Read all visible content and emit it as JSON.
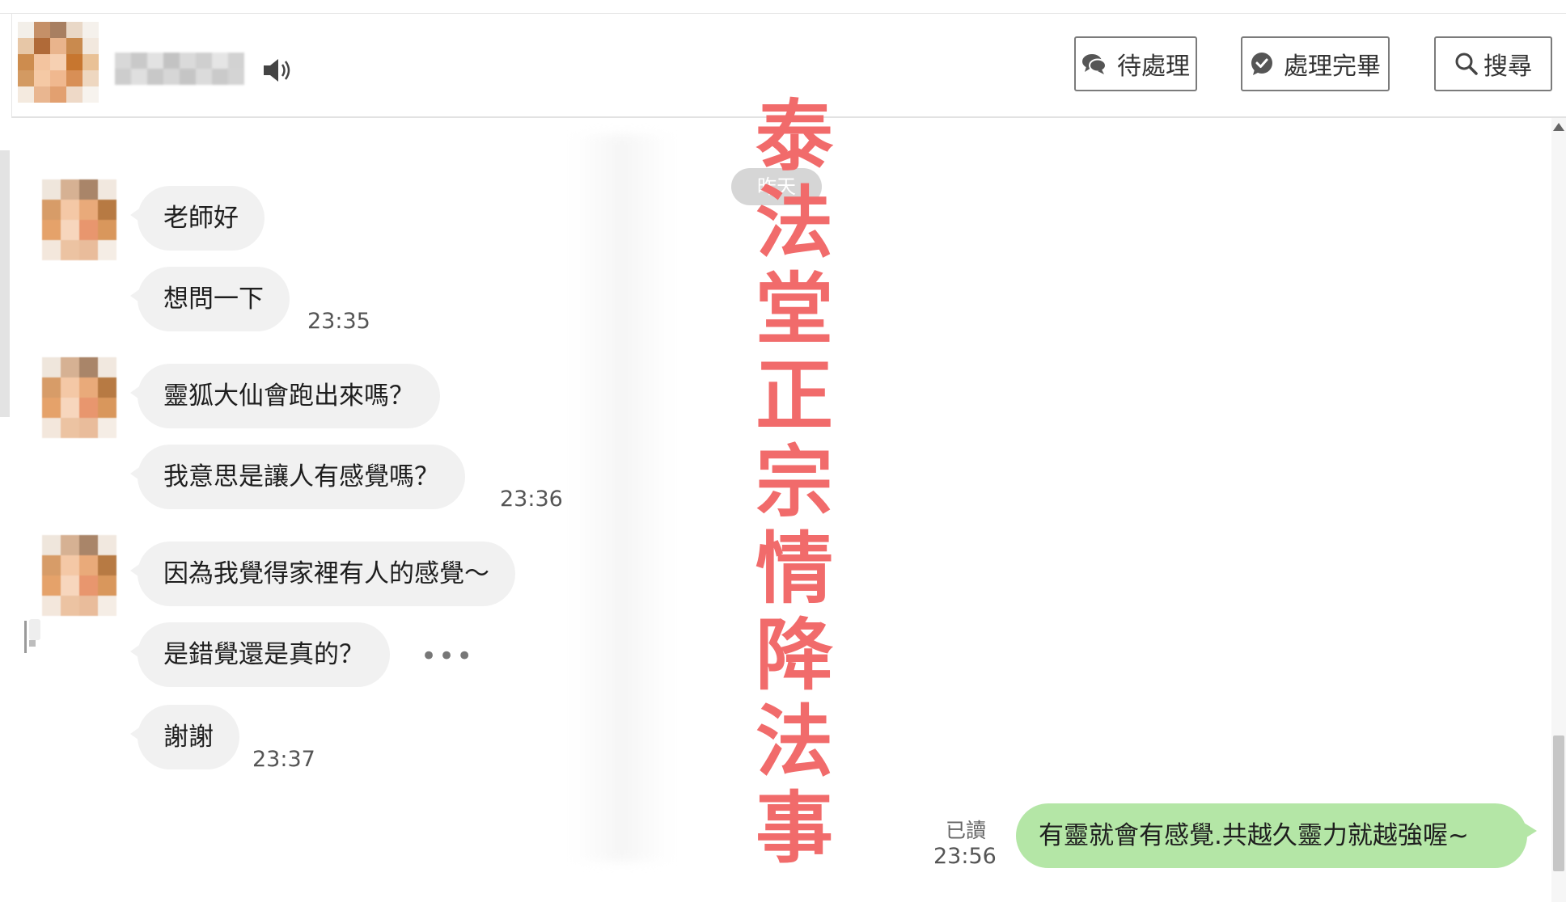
{
  "header": {
    "pending_label": "待處理",
    "done_label": "處理完畢",
    "search_label": "搜尋"
  },
  "chat": {
    "day_label": "昨天",
    "incoming": [
      {
        "text": "老師好",
        "time": ""
      },
      {
        "text": "想問一下",
        "time": "23:35"
      },
      {
        "text": "靈狐大仙會跑出來嗎？",
        "time": ""
      },
      {
        "text": "我意思是讓人有感覺嗎？",
        "time": "23:36"
      },
      {
        "text": "因為我覺得家裡有人的感覺～",
        "time": ""
      },
      {
        "text": "是錯覺還是真的？",
        "time": ""
      },
      {
        "text": "謝謝",
        "time": "23:37"
      }
    ],
    "more_indicator": "•••",
    "outgoing": {
      "read_label": "已讀",
      "time": "23:56",
      "text": "有靈就會有感覺.共越久靈力就越強喔~"
    }
  },
  "watermark": {
    "chars": [
      "泰",
      "法",
      "堂",
      "正",
      "宗",
      "情",
      "降",
      "法",
      "事"
    ]
  },
  "colors": {
    "watermark": "#f16b6b",
    "outgoing_bubble": "#b4e6a6",
    "incoming_bubble": "#f1f1f1",
    "read_badge": "#d6d6d6"
  },
  "icons": [
    "speaker-icon",
    "chat-bubbles-icon",
    "check-bubble-icon",
    "search-icon"
  ]
}
